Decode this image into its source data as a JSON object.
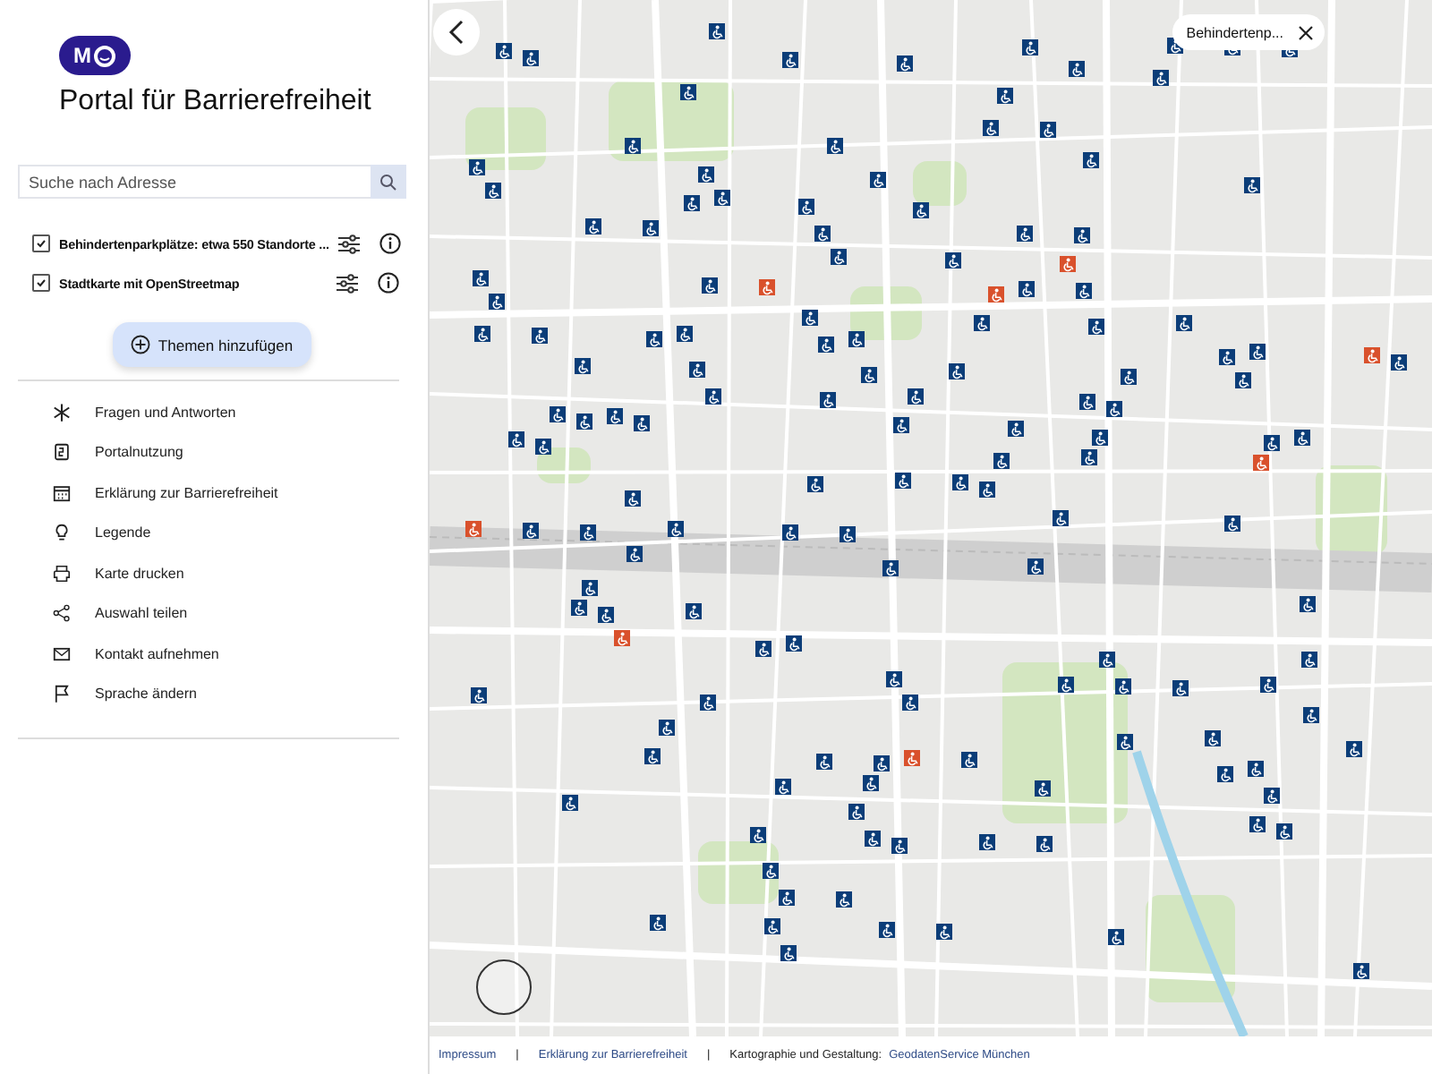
{
  "sidebar": {
    "logo": "M",
    "title": "Portal für Barrierefreiheit",
    "search": {
      "placeholder": "Suche nach Adresse"
    },
    "layers": [
      {
        "label": "Behindertenparkplätze: etwa 550 Standorte ...",
        "checked": true
      },
      {
        "label": "Stadtkarte mit OpenStreetmap",
        "checked": true
      }
    ],
    "add_button": "Themen hinzufügen",
    "menu": [
      {
        "kind": "asterisk",
        "label": "Fragen und Antworten"
      },
      {
        "kind": "guide",
        "label": "Portalnutzung"
      },
      {
        "kind": "calendar",
        "label": "Erklärung zur Barrierefreiheit"
      },
      {
        "kind": "bulb",
        "label": "Legende"
      },
      {
        "kind": "printer",
        "label": "Karte drucken"
      },
      {
        "kind": "share",
        "label": "Auswahl teilen"
      },
      {
        "kind": "mail",
        "label": "Kontakt aufnehmen"
      },
      {
        "kind": "flag",
        "label": "Sprache ändern"
      }
    ]
  },
  "map": {
    "chip": "Behindertenp..."
  },
  "footer": [
    {
      "kind": "link",
      "text": "Impressum"
    },
    {
      "kind": "sep",
      "text": "|"
    },
    {
      "kind": "link",
      "text": "Erklärung zur Barrierefreiheit"
    },
    {
      "kind": "sep",
      "text": "|"
    },
    {
      "kind": "plain",
      "text": "Kartographie und Gestaltung:"
    },
    {
      "kind": "link",
      "text": "GeodatenService München"
    }
  ]
}
